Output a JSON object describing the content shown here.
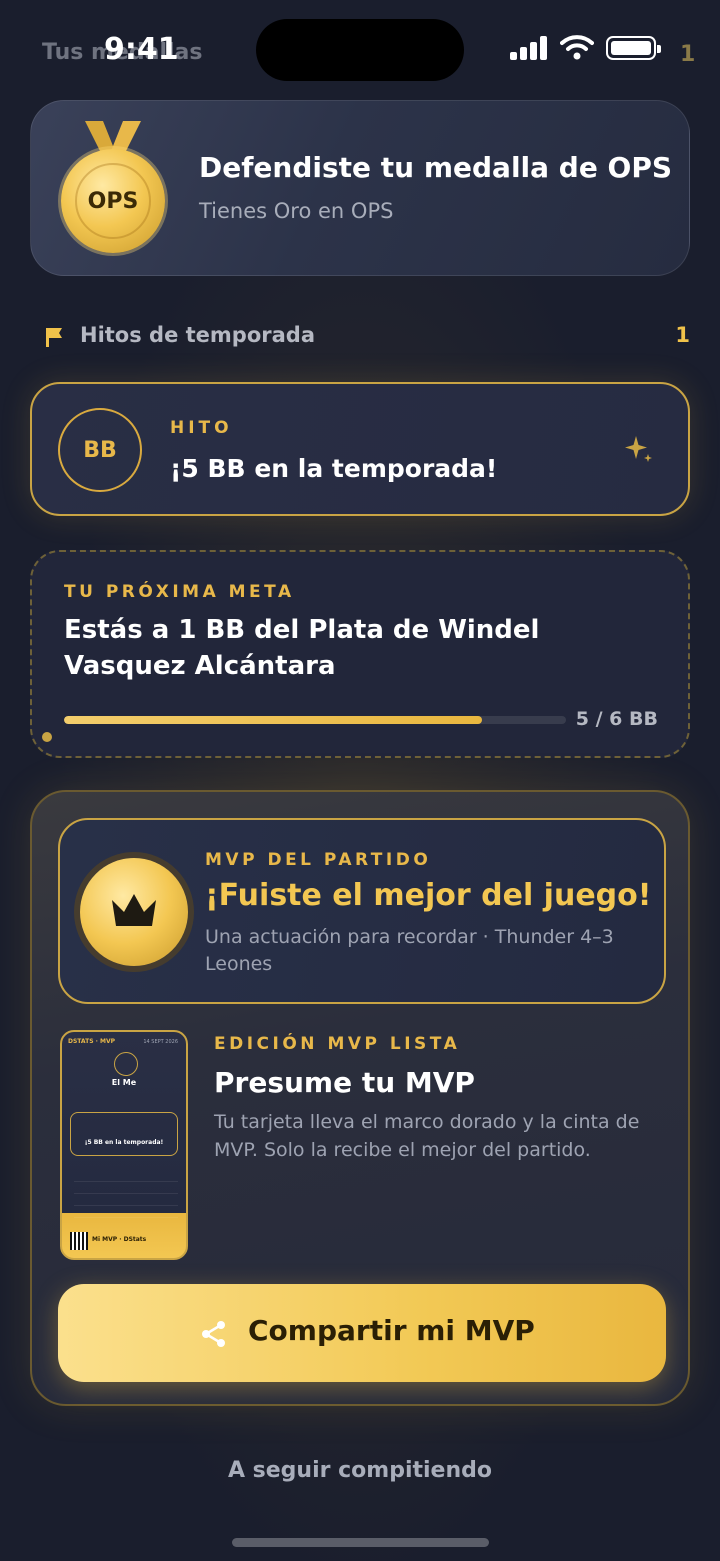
{
  "status_bar": {
    "time": "9:41",
    "behind_title": "Tus medallas",
    "behind_count": "1"
  },
  "medal_card": {
    "medal_text": "OPS",
    "title": "Defendiste tu medalla de OPS",
    "subtitle": "Tienes Oro en OPS"
  },
  "section": {
    "label": "Hitos de temporada",
    "count": "1"
  },
  "hito": {
    "badge": "BB",
    "label": "HITO",
    "title": "¡5 BB en la temporada!"
  },
  "goal": {
    "label": "TU PRÓXIMA META",
    "title": "Estás a 1 BB del Plata de Windel Vasquez Alcántara",
    "progress_current": 5,
    "progress_total": 6,
    "progress_text": "5 / 6 BB"
  },
  "mvp": {
    "label": "MVP DEL PARTIDO",
    "title": "¡Fuiste el mejor del juego!",
    "subtitle": "Una actuación para recordar · Thunder 4–3 Leones",
    "edition_label": "EDICIÓN MVP LISTA",
    "edition_title": "Presume tu MVP",
    "edition_desc": "Tu tarjeta lleva el marco dorado y la cinta de MVP. Solo la recibe el mejor del partido.",
    "share_label": "Compartir mi MVP",
    "mini_card": {
      "head": "DSTATS · MVP",
      "date": "14 SEPT 2026",
      "name": "El Me",
      "box_text": "¡5 BB en la temporada!",
      "foot": "Mi MVP · DStats"
    }
  },
  "footer": {
    "continue_label": "A seguir compitiendo"
  },
  "colors": {
    "gold": "#e8b84a",
    "background": "#1a1e2d"
  }
}
